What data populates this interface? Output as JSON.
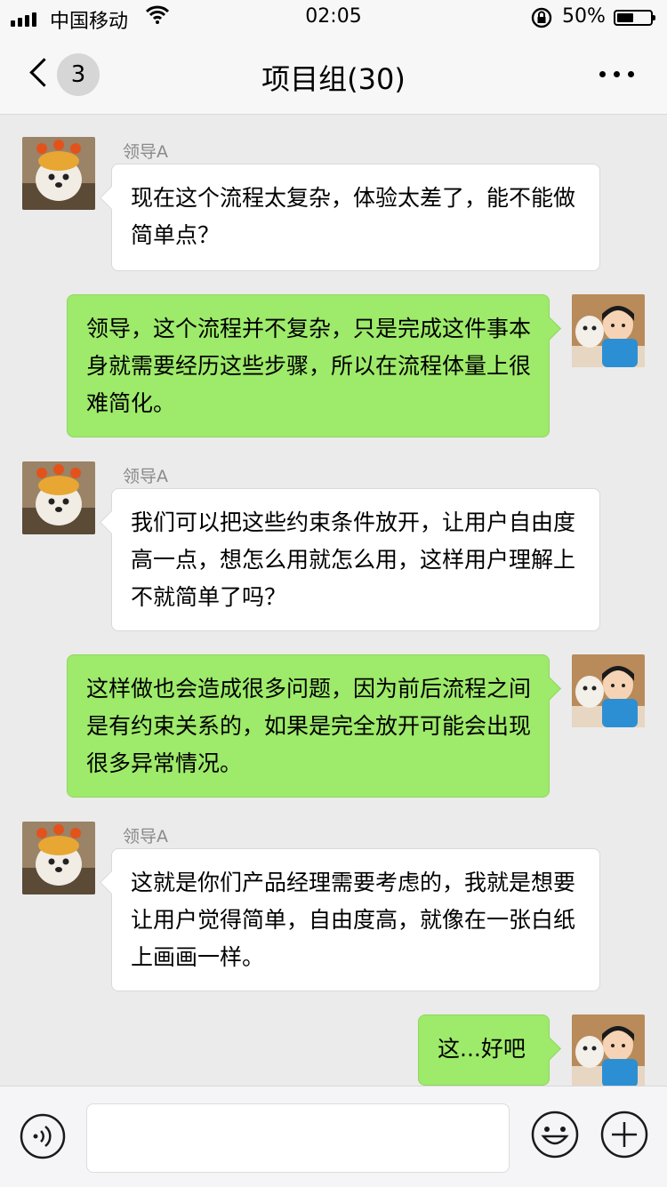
{
  "status_bar": {
    "carrier": "中国移动",
    "time": "02:05",
    "battery_percent": "50%",
    "battery_level": 0.5,
    "icons": [
      "signal-icon",
      "wifi-icon",
      "rotation-lock-icon",
      "battery-icon"
    ]
  },
  "nav": {
    "back_icon": "chevron-left-icon",
    "unread_count": "3",
    "title": "项目组(30)",
    "more_icon": "more-dots-icon"
  },
  "messages": [
    {
      "side": "left",
      "sender": "领导A",
      "text": "现在这个流程太复杂，体验太差了，能不能做简单点？"
    },
    {
      "side": "right",
      "text": "领导，这个流程并不复杂，只是完成这件事本身就需要经历这些步骤，所以在流程体量上很难简化。"
    },
    {
      "side": "left",
      "sender": "领导A",
      "text": "我们可以把这些约束条件放开，让用户自由度高一点，想怎么用就怎么用，这样用户理解上不就简单了吗？"
    },
    {
      "side": "right",
      "text": "这样做也会造成很多问题，因为前后流程之间是有约束关系的，如果是完全放开可能会出现很多异常情况。"
    },
    {
      "side": "left",
      "sender": "领导A",
      "text": "这就是你们产品经理需要考虑的，我就是想要让用户觉得简单，自由度高，就像在一张白纸上画画一样。"
    },
    {
      "side": "right",
      "text": "这...好吧"
    }
  ],
  "input_bar": {
    "voice_icon": "voice-icon",
    "placeholder": "",
    "emoji_icon": "emoji-icon",
    "add_icon": "plus-circle-icon"
  },
  "colors": {
    "background": "#ebebeb",
    "self_bubble": "#9eea6a",
    "other_bubble": "#ffffff",
    "sender_name": "#8a8a8a"
  }
}
